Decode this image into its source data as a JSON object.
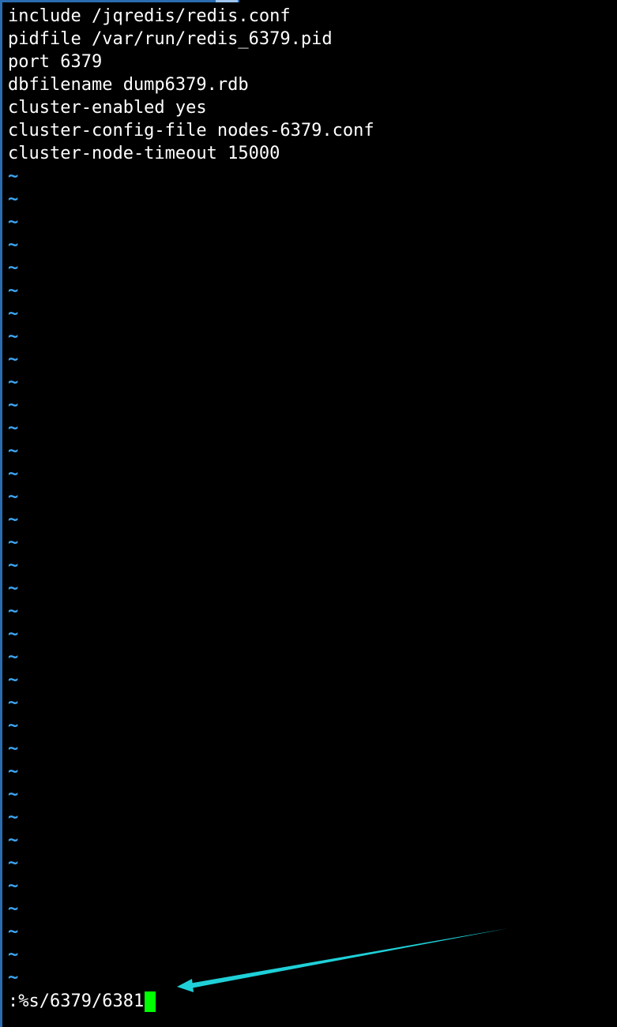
{
  "editor": {
    "lines": [
      "include /jqredis/redis.conf",
      "pidfile /var/run/redis_6379.pid",
      "port 6379",
      "dbfilename dump6379.rdb",
      "cluster-enabled yes",
      "cluster-config-file nodes-6379.conf",
      "cluster-node-timeout 15000"
    ],
    "empty_line_marker": "~",
    "empty_line_count": 36,
    "command": ":%s/6379/6381"
  },
  "colors": {
    "background": "#000000",
    "text": "#ffffff",
    "tilde": "#3ea6f2",
    "cursor": "#00ff00",
    "annotation_arrow": "#1fd0d8"
  },
  "icons": {
    "annotation": "arrow-icon"
  }
}
